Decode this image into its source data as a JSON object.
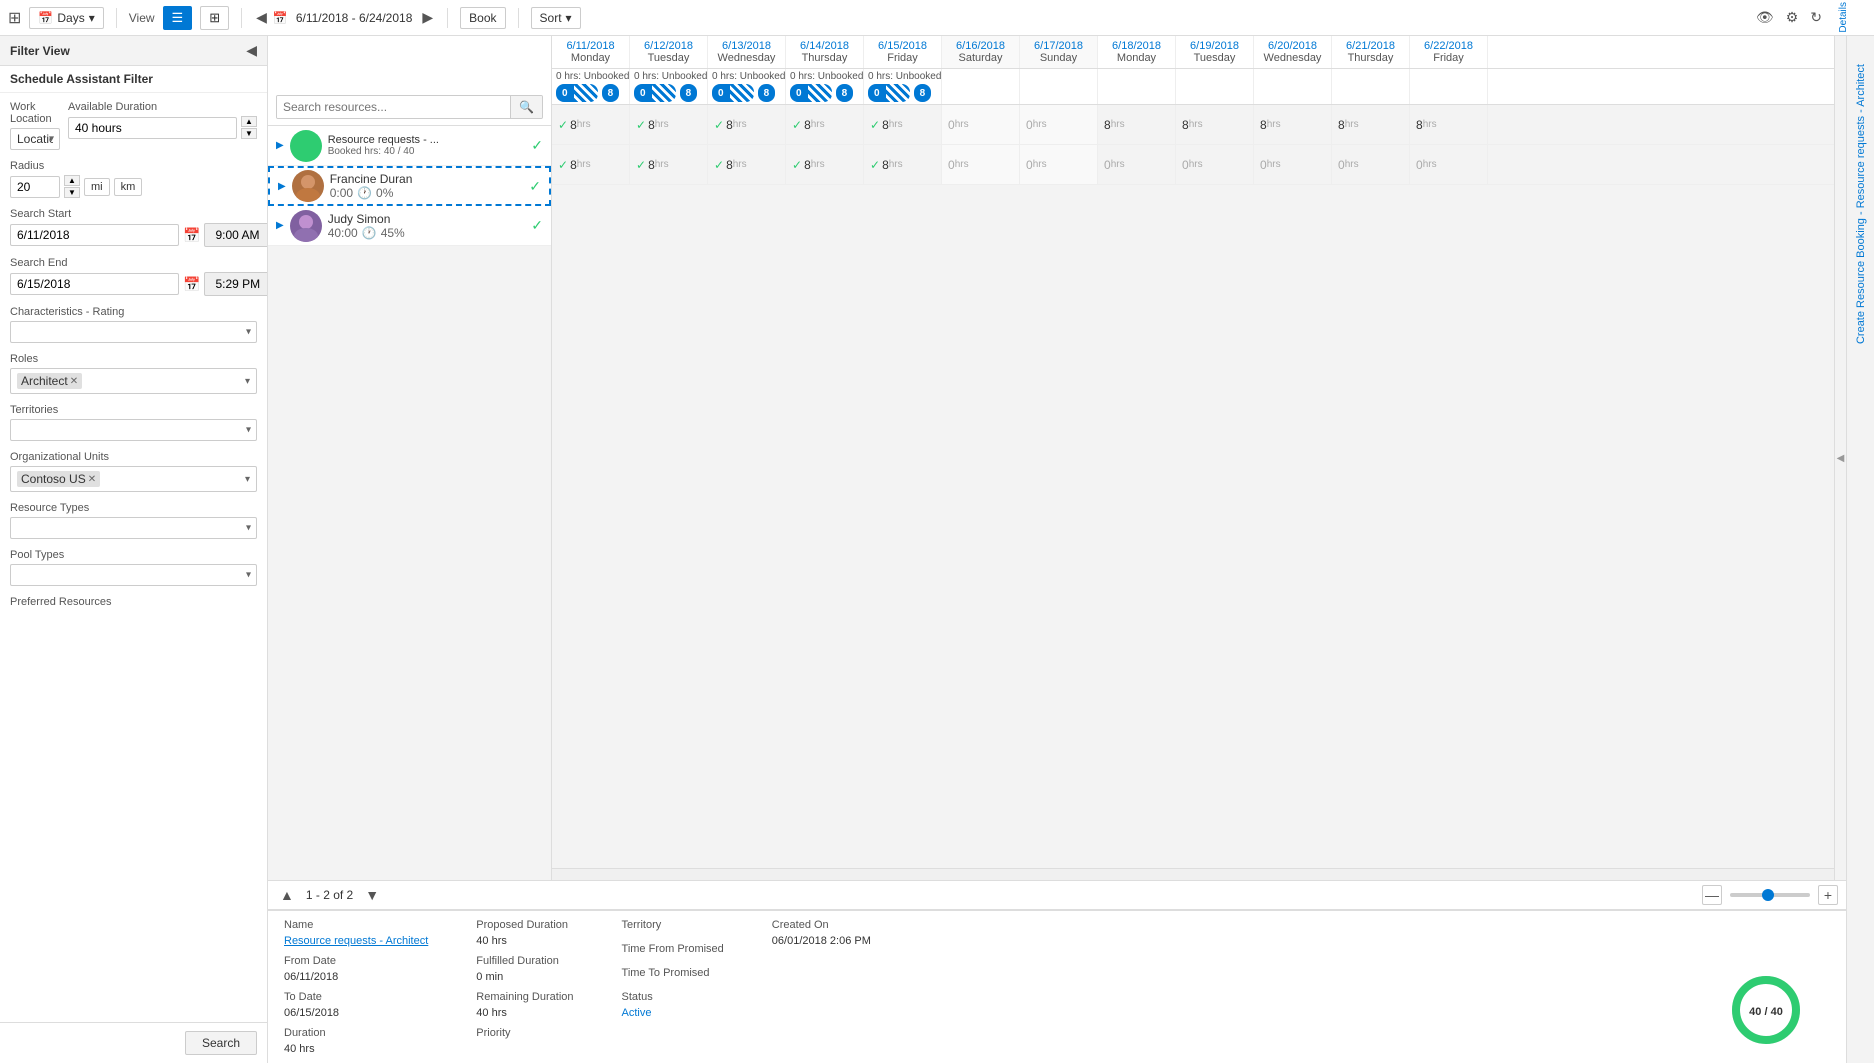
{
  "toolbar": {
    "days_label": "Days",
    "view_label": "View",
    "date_range": "6/11/2018 - 6/24/2018",
    "book_label": "Book",
    "sort_label": "Sort",
    "eye_icon": "👁",
    "gear_icon": "⚙",
    "refresh_icon": "↻",
    "details_label": "Details"
  },
  "filter": {
    "header": "Filter View",
    "subheader": "Schedule Assistant Filter",
    "work_location_label": "Work Location",
    "work_location_value": "Location Agnostic",
    "available_duration_label": "Available Duration",
    "available_duration_value": "40 hours",
    "radius_label": "Radius",
    "radius_value": "20",
    "mi_label": "mi",
    "km_label": "km",
    "search_start_label": "Search Start",
    "search_start_date": "6/11/2018",
    "search_start_time": "9:00 AM",
    "search_end_label": "Search End",
    "search_end_date": "6/15/2018",
    "search_end_time": "5:29 PM",
    "characteristics_label": "Characteristics - Rating",
    "roles_label": "Roles",
    "roles_tag": "Architect",
    "territories_label": "Territories",
    "org_units_label": "Organizational Units",
    "org_units_tag": "Contoso US",
    "resource_types_label": "Resource Types",
    "pool_types_label": "Pool Types",
    "preferred_resources_label": "Preferred Resources",
    "search_btn": "Search"
  },
  "schedule": {
    "resource_search_placeholder": "Search resources...",
    "resource_requests_name": "Resource requests - ...",
    "resource_requests_sub": "Booked hrs: 40 / 40",
    "people": [
      {
        "name": "Francine Duran",
        "sub1": "0:00",
        "sub2": "0%",
        "selected": true
      },
      {
        "name": "Judy Simon",
        "sub1": "40:00",
        "sub2": "45%",
        "selected": false
      }
    ],
    "columns": [
      {
        "date": "6/11/2018",
        "day": "Monday",
        "weekend": false
      },
      {
        "date": "6/12/2018",
        "day": "Tuesday",
        "weekend": false
      },
      {
        "date": "6/13/2018",
        "day": "Wednesday",
        "weekend": false
      },
      {
        "date": "6/14/2018",
        "day": "Thursday",
        "weekend": false
      },
      {
        "date": "6/15/2018",
        "day": "Friday",
        "weekend": false
      },
      {
        "date": "6/16/2018",
        "day": "Saturday",
        "weekend": true
      },
      {
        "date": "6/17/2018",
        "day": "Sunday",
        "weekend": true
      },
      {
        "date": "6/18/2018",
        "day": "Monday",
        "weekend": false
      },
      {
        "date": "6/19/2018",
        "day": "Tuesday",
        "weekend": false
      },
      {
        "date": "6/20/2018",
        "day": "Wednesday",
        "weekend": false
      },
      {
        "date": "6/21/2018",
        "day": "Thursday",
        "weekend": false
      },
      {
        "date": "6/22/2018",
        "day": "Friday",
        "weekend": false
      }
    ],
    "status_row": {
      "unbooked_prefix": "0 hrs: Unbooked",
      "booked_count": "8",
      "pills": [
        "0",
        "8",
        "0",
        "8",
        "0",
        "8",
        "0",
        "8",
        "0",
        "8"
      ]
    },
    "francine_hours": [
      "8",
      "8",
      "8",
      "8",
      "8",
      "0",
      "0",
      "8",
      "8",
      "8",
      "8",
      "8"
    ],
    "judy_hours": [
      "8",
      "8",
      "8",
      "8",
      "8",
      "0",
      "0",
      "0",
      "0",
      "0",
      "0",
      "0"
    ],
    "francine_booked": [
      true,
      true,
      true,
      true,
      true,
      false,
      false,
      false,
      false,
      false,
      false,
      false
    ],
    "judy_booked": [
      true,
      true,
      true,
      true,
      true,
      false,
      false,
      false,
      false,
      false,
      false,
      false
    ]
  },
  "pagination": {
    "info": "1 - 2 of 2"
  },
  "bottom_info": {
    "name_label": "Name",
    "name_value": "Resource requests - Architect",
    "from_date_label": "From Date",
    "from_date_value": "06/11/2018",
    "to_date_label": "To Date",
    "to_date_value": "06/15/2018",
    "duration_label": "Duration",
    "duration_value": "40 hrs",
    "proposed_duration_label": "Proposed Duration",
    "proposed_duration_value": "40 hrs",
    "fulfilled_duration_label": "Fulfilled Duration",
    "fulfilled_duration_value": "0 min",
    "remaining_duration_label": "Remaining Duration",
    "remaining_duration_value": "40 hrs",
    "priority_label": "Priority",
    "priority_value": "",
    "territory_label": "Territory",
    "territory_value": "",
    "time_from_promised_label": "Time From Promised",
    "time_from_promised_value": "",
    "time_to_promised_label": "Time To Promised",
    "time_to_promised_value": "",
    "status_label": "Status",
    "status_value": "Active",
    "created_on_label": "Created On",
    "created_on_value": "06/01/2018 2:06 PM",
    "donut_label": "40 / 40",
    "donut_booked": 40,
    "donut_total": 40
  },
  "right_sidebar": {
    "create_label": "Create Resource Booking - Resource requests - Architect"
  }
}
